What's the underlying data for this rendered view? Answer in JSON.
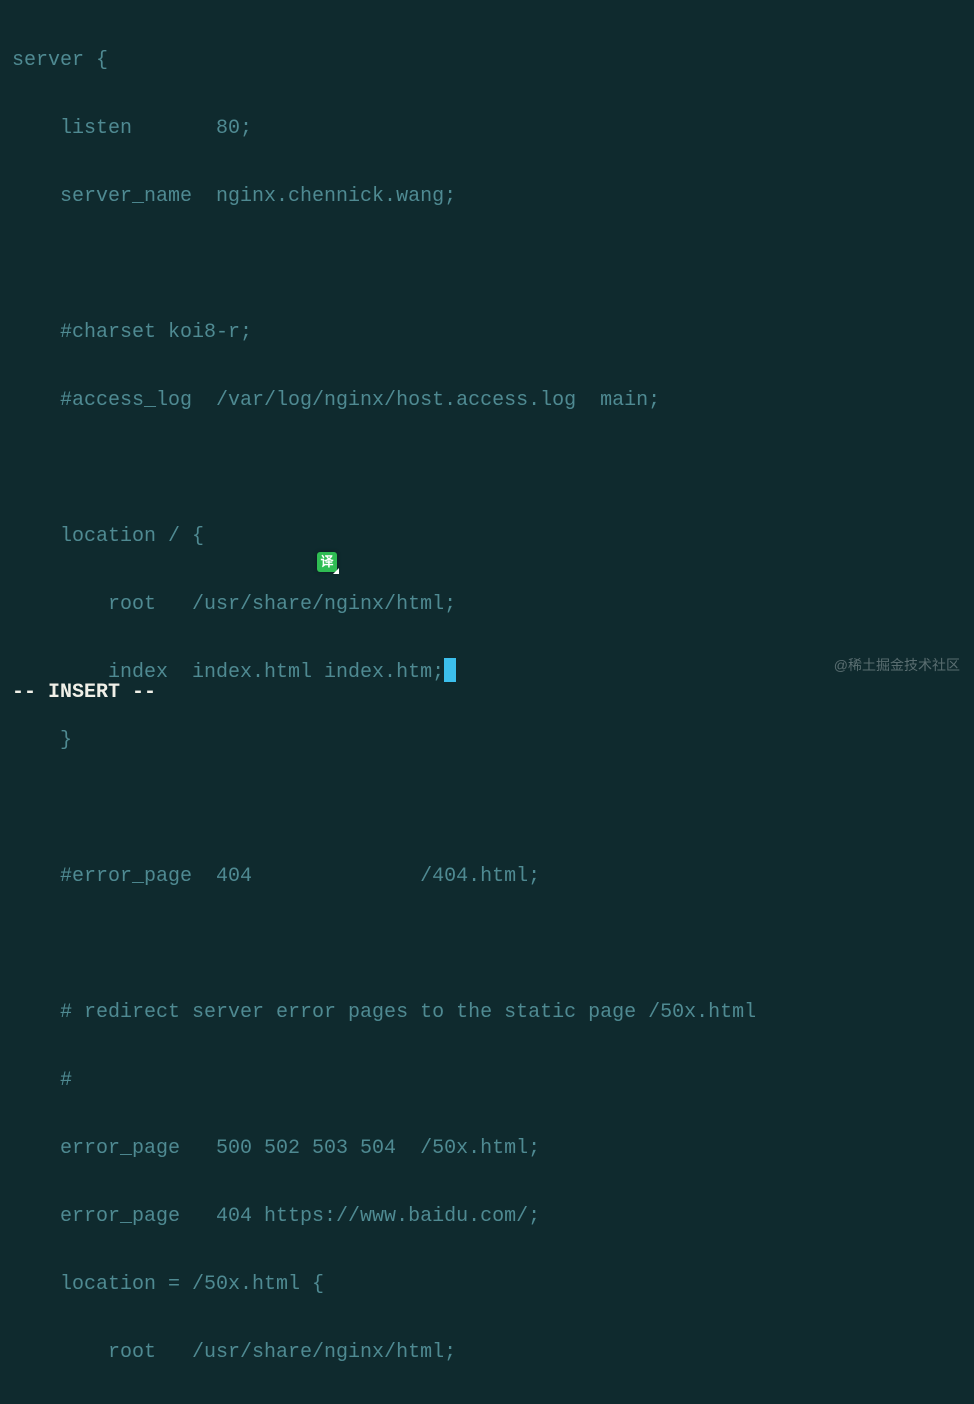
{
  "code": {
    "l1": "server {",
    "l2": "    listen       80;",
    "l3": "    server_name  nginx.chennick.wang;",
    "l4": "",
    "l5": "    #charset koi8-r;",
    "l6": "    #access_log  /var/log/nginx/host.access.log  main;",
    "l7": "",
    "l8": "    location / {",
    "l9": "        root   /usr/share/nginx/html;",
    "l10a": "        index  index.html index.htm;",
    "l11": "    }",
    "l12": "",
    "l13": "    #error_page  404              /404.html;",
    "l14": "",
    "l15": "    # redirect server error pages to the static page /50x.html",
    "l16": "    #",
    "l17": "    error_page   500 502 503 504  /50x.html;",
    "l18": "    error_page   404 https://www.baidu.com/;",
    "l19": "    location = /50x.html {",
    "l20": "        root   /usr/share/nginx/html;"
  },
  "status": "-- INSERT --",
  "watermark": "@稀土掘金技术社区",
  "translate_label": "译"
}
